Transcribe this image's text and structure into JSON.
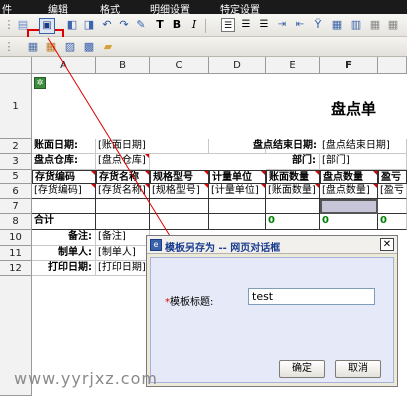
{
  "menu": [
    "件",
    "编辑",
    "格式",
    "明细设置",
    "特定设置"
  ],
  "toolbar": {
    "row1_icons": [
      "save-template-as-icon",
      "print-preview-icon",
      "preview-icon",
      "undo-icon",
      "redo-icon",
      "format-painter-icon",
      "font-icon",
      "bold-icon",
      "italic-icon",
      "align-left-icon",
      "align-center-icon",
      "align-right-icon",
      "merge-cells-icon",
      "split-cells-icon",
      "filter-icon",
      "insert-row-icon",
      "insert-column-icon"
    ],
    "row2_icons": [
      "grid-icon",
      "table-icon",
      "image-icon",
      "chart-icon",
      "folder-icon"
    ]
  },
  "sheet": {
    "columns": [
      "A",
      "B",
      "C",
      "D",
      "E",
      "F"
    ],
    "rows": [
      "1",
      "2",
      "3",
      "5",
      "6",
      "7",
      "8",
      "10",
      "11",
      "12"
    ],
    "title": "盘点单",
    "row2": {
      "a": "账面日期:",
      "b": "[账面日期]",
      "e": "盘点结束日期:",
      "f": "[盘点结束日期]"
    },
    "row3": {
      "a": "盘点仓库:",
      "b": "[盘点仓库]",
      "e": "部门:",
      "f": "[部门]"
    },
    "row5": [
      "存货编码",
      "存货名称",
      "规格型号",
      "计量单位",
      "账面数量",
      "盘点数量",
      "盈亏"
    ],
    "row6": [
      "[存货编码]",
      "[存货名称]",
      "[规格型号]",
      "[计量单位]",
      "[账面数量]",
      "[盘点数量]",
      "[盈亏"
    ],
    "row8": {
      "a": "合计",
      "e": "0",
      "f": "0",
      "g": "0"
    },
    "row10": {
      "a": "备注:",
      "b": "[备注]"
    },
    "row11": {
      "a": "制单人:",
      "b": "[制单人]"
    },
    "row12": {
      "a": "打印日期:",
      "b": "[打印日期]"
    }
  },
  "dialog": {
    "title": "模板另存为 -- 网页对话框",
    "field_label": "模板标题:",
    "field_value": "test",
    "ok_label": "确定",
    "cancel_label": "取消"
  },
  "watermark": "www.yyrjxz.com",
  "colors": {
    "highlight": "#e00000",
    "dialog_title_text": "#1a3c8f",
    "watermark": "#8a8a8a",
    "total_green": "#008000"
  }
}
